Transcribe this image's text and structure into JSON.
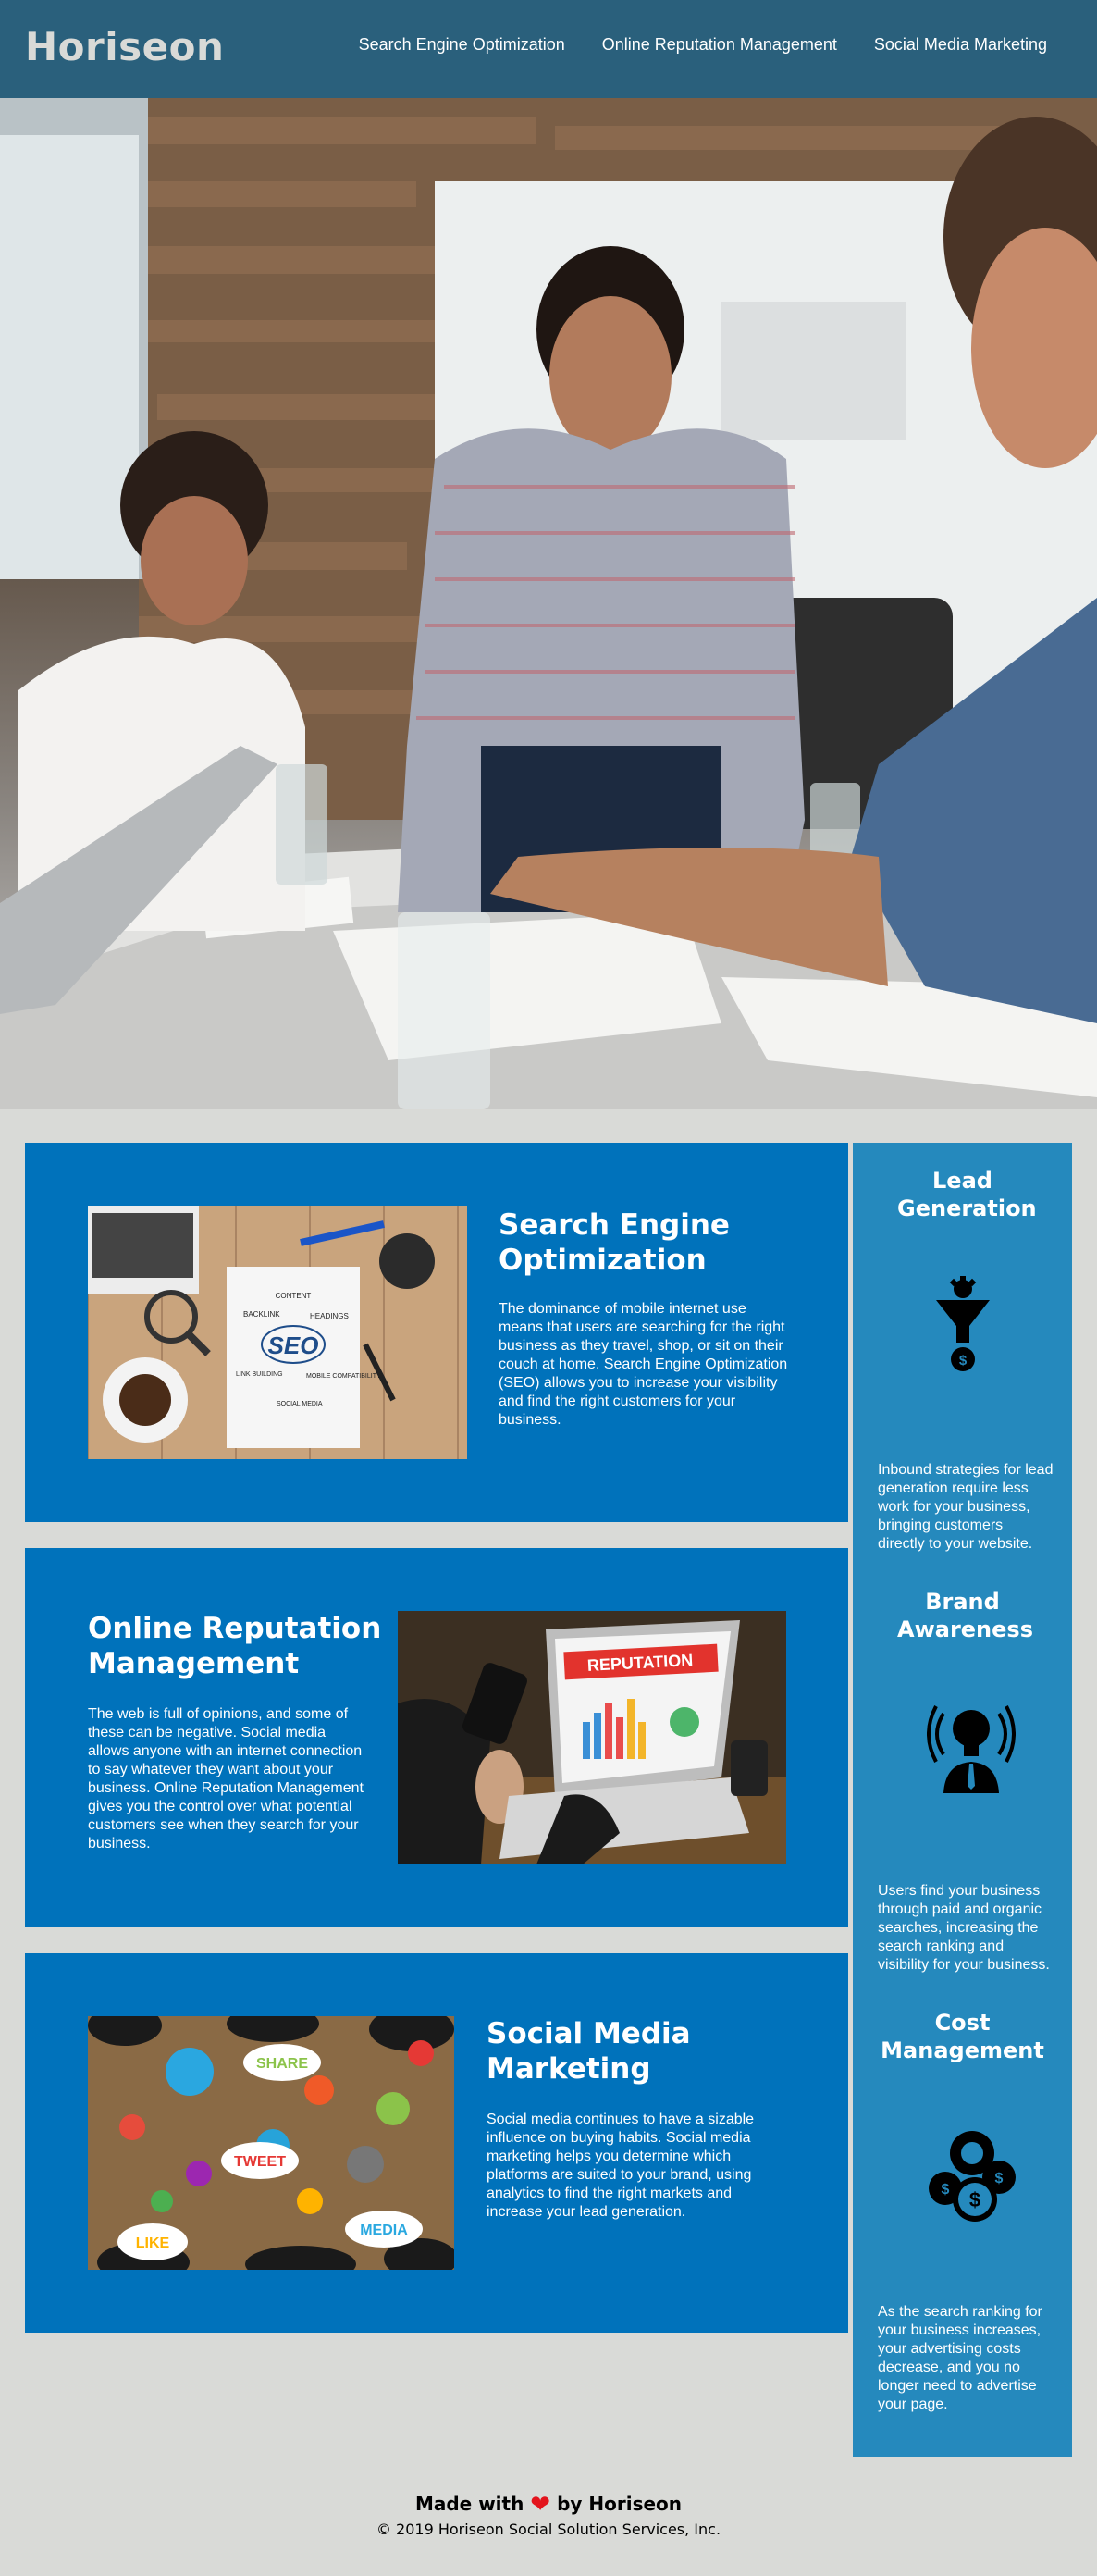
{
  "header": {
    "logo": "Horiseon",
    "nav": [
      {
        "label": "Search Engine Optimization"
      },
      {
        "label": "Online Reputation Management"
      },
      {
        "label": "Social Media Marketing"
      }
    ]
  },
  "sections": {
    "seo": {
      "title": "Search Engine Optimization",
      "body": "The dominance of mobile internet use means that users are searching for the right business as they travel, shop, or sit on their couch at home. Search Engine Optimization (SEO) allows you to increase your visibility and find the right customers for your business."
    },
    "orm": {
      "title": "Online Reputation Management",
      "body": "The web is full of opinions, and some of these can be negative. Social media allows anyone with an internet connection to say whatever they want about your business. Online Reputation Management gives you the control over what potential customers see when they search for your business."
    },
    "smm": {
      "title": "Social Media Marketing",
      "body": "Social media continues to have a sizable influence on buying habits. Social media marketing helps you determine which platforms are suited to your brand, using analytics to find the right markets and increase your lead generation."
    }
  },
  "benefits": [
    {
      "title": "Lead Generation",
      "icon": "lead-generation-icon",
      "text": "Inbound strategies for lead generation require less work for your business, bringing customers directly to your website."
    },
    {
      "title": "Brand Awareness",
      "icon": "brand-awareness-icon",
      "text": "Users find your business through paid and organic searches, increasing the search ranking and visibility for your business."
    },
    {
      "title": "Cost Management",
      "icon": "cost-management-icon",
      "text": "As the search ranking for your business increases, your advertising costs decrease, and you no longer need to advertise your page."
    }
  ],
  "image_text": {
    "seo_notebook": "SEO",
    "seo_tags": [
      "CONTENT",
      "BACKLINK",
      "HEADINGS",
      "LINK BUILDING",
      "MOBILE COMPATIBILITY",
      "SOCIAL MEDIA"
    ],
    "reputation_banner": "REPUTATION",
    "social_bubbles": [
      "SHARE",
      "TWEET",
      "LIKE",
      "MEDIA"
    ]
  },
  "footer": {
    "made_prefix": "Made with",
    "made_suffix": "by Horiseon",
    "copyright": "© 2019 Horiseon Social Solution Services, Inc."
  },
  "colors": {
    "header": "#2a607c",
    "card": "#0072bb",
    "sidebar": "#2589bd",
    "page": "#d9dad7",
    "heart": "#e3141c"
  }
}
